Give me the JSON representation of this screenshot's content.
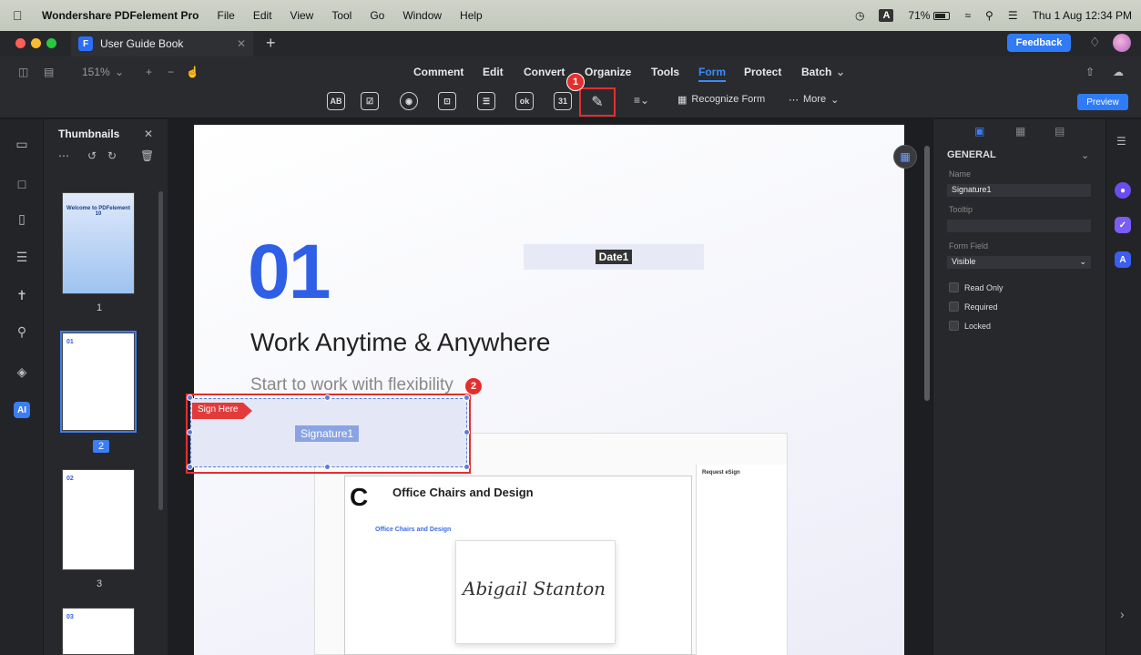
{
  "menubar": {
    "app_name": "Wondershare PDFelement Pro",
    "items": [
      "File",
      "Edit",
      "View",
      "Tool",
      "Go",
      "Window",
      "Help"
    ],
    "badge": "A",
    "battery": "71%",
    "datetime": "Thu 1 Aug  12:34 PM"
  },
  "window": {
    "tab_title": "User Guide Book",
    "tab_logo": "F",
    "feedback_label": "Feedback"
  },
  "toolbar": {
    "zoom": "151%",
    "menu": [
      "Comment",
      "Edit",
      "Convert",
      "Organize",
      "Tools",
      "Form",
      "Protect",
      "Batch"
    ],
    "active_menu": "Form",
    "form_tools": [
      "AB",
      "☑",
      "◉",
      "⊡",
      "☰",
      "ok",
      "31"
    ],
    "recognize_form": "Recognize Form",
    "more": "More",
    "preview": "Preview",
    "callout_1": "1"
  },
  "thumbnails": {
    "title": "Thumbnails",
    "pages": [
      {
        "label": "1",
        "selected": false,
        "heading": "Welcome to PDFelement 10"
      },
      {
        "label": "2",
        "selected": true,
        "heading": "01"
      },
      {
        "label": "3",
        "selected": false,
        "heading": "02"
      },
      {
        "label": "",
        "selected": false,
        "heading": "03"
      }
    ]
  },
  "page": {
    "big_number": "01",
    "date_field": "Date1",
    "heading": "Work Anytime & Anywhere",
    "subheading": "Start to work with flexibility",
    "sign_here": "Sign Here",
    "signature_field": "Signature1",
    "callout_2": "2",
    "embedded": {
      "logo": "C",
      "title": "Office Chairs and Design",
      "table_header": "Office Chairs and Design",
      "signature_text": "Abigail Stanton",
      "panel_title": "Request eSign"
    }
  },
  "properties": {
    "section": "GENERAL",
    "name_label": "Name",
    "name_value": "Signature1",
    "tooltip_label": "Tooltip",
    "tooltip_value": "",
    "form_field_label": "Form Field",
    "form_field_value": "Visible",
    "checkboxes": [
      "Read Only",
      "Required",
      "Locked"
    ]
  },
  "colors": {
    "accent": "#2f7bf6",
    "highlight": "#e52e2e",
    "big_number": "#2e5fe6"
  }
}
